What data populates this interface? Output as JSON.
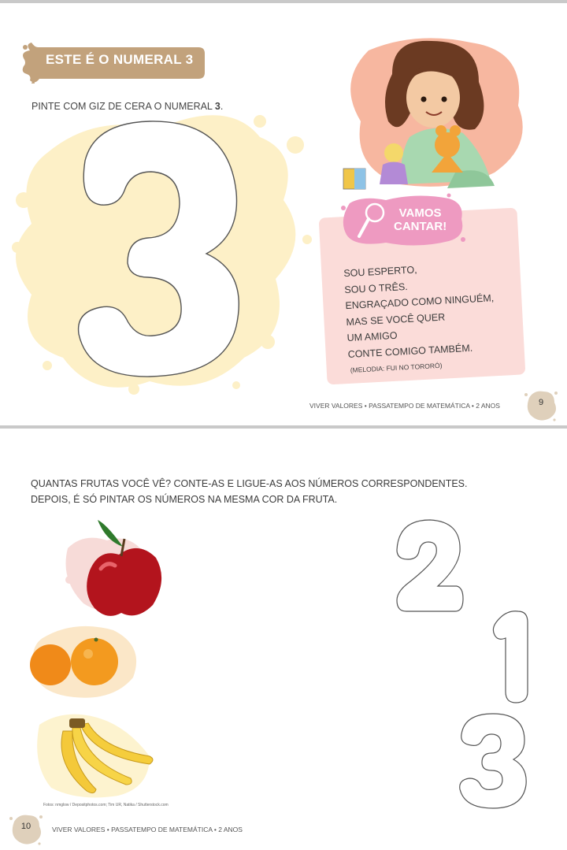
{
  "page1": {
    "title": "ESTE É O NUMERAL 3",
    "instruction_prefix": "PINTE COM GIZ DE CERA O NUMERAL ",
    "instruction_number": "3",
    "instruction_suffix": ".",
    "big_numeral": "3",
    "sing_badge": {
      "line1": "VAMOS",
      "line2": "CANTAR!"
    },
    "song_lines": [
      "SOU ESPERTO,",
      "SOU O TRÊS.",
      "ENGRAÇADO COMO NINGUÉM,",
      "MAS SE VOCÊ QUER",
      "UM AMIGO",
      "CONTE COMIGO TAMBÉM."
    ],
    "melody": "(MELODIA: FUI NO TORORÓ)",
    "footer": "VIVER VALORES • PASSATEMPO DE MATEMÁTICA • 2 ANOS",
    "page_number": "9"
  },
  "page2": {
    "instruction_lines": [
      "QUANTAS FRUTAS VOCÊ VÊ? CONTE-AS E LIGUE-AS AOS NÚMEROS CORRESPONDENTES.",
      "DEPOIS, É SÓ PINTAR OS NÚMEROS NA MESMA COR DA FRUTA."
    ],
    "numerals": [
      "2",
      "1",
      "3"
    ],
    "credits": "Fotos: nmglow / Depositphotos.com; Tim UR, Natika / Shutterstock.com",
    "footer": "VIVER VALORES • PASSATEMPO DE MATEMÁTICA • 2 ANOS",
    "page_number": "10"
  },
  "colors": {
    "title_badge": "#c2a27c",
    "splash_yellow": "#fdf0c7",
    "song_card": "#fbdcd9",
    "sing_badge": "#ee9ac1",
    "page_number_badge": "#dfd0bb"
  }
}
